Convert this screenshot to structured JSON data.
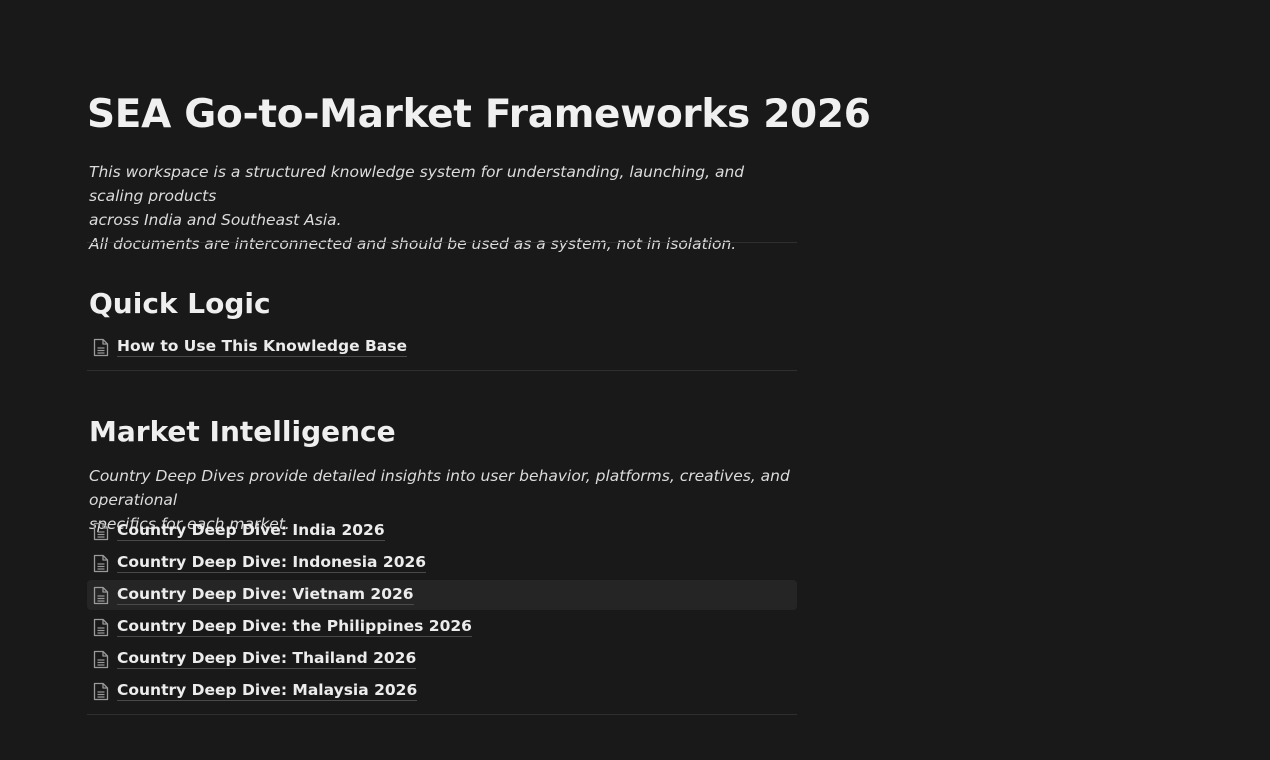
{
  "page": {
    "title": "SEA Go-to-Market Frameworks 2026",
    "intro_lines": [
      "This workspace is a structured knowledge system for understanding, launching, and scaling products",
      "across India and Southeast Asia.",
      "All documents are interconnected and should be used as a system, not in isolation."
    ]
  },
  "quick_logic": {
    "heading": "Quick Logic",
    "links": [
      {
        "label": "How to Use This Knowledge Base",
        "icon": "page-icon"
      }
    ]
  },
  "market_intelligence": {
    "heading": "Market Intelligence",
    "description_lines": [
      "Country Deep Dives provide detailed insights into user behavior, platforms, creatives, and operational",
      "specifics for each market."
    ],
    "links": [
      {
        "label": "Country Deep Dive: India 2026",
        "icon": "page-icon"
      },
      {
        "label": "Country Deep Dive: Indonesia 2026",
        "icon": "page-icon"
      },
      {
        "label": "Country Deep Dive: Vietnam 2026",
        "icon": "page-icon",
        "hovered": true
      },
      {
        "label": "Country Deep Dive: the Philippines 2026",
        "icon": "page-icon"
      },
      {
        "label": "Country Deep Dive: Thailand 2026",
        "icon": "page-icon"
      },
      {
        "label": "Country Deep Dive: Malaysia 2026",
        "icon": "page-icon"
      }
    ]
  },
  "colors": {
    "background": "#191919",
    "text": "#e6e6e6",
    "divider": "#2f2f2f",
    "hover": "#252525"
  }
}
